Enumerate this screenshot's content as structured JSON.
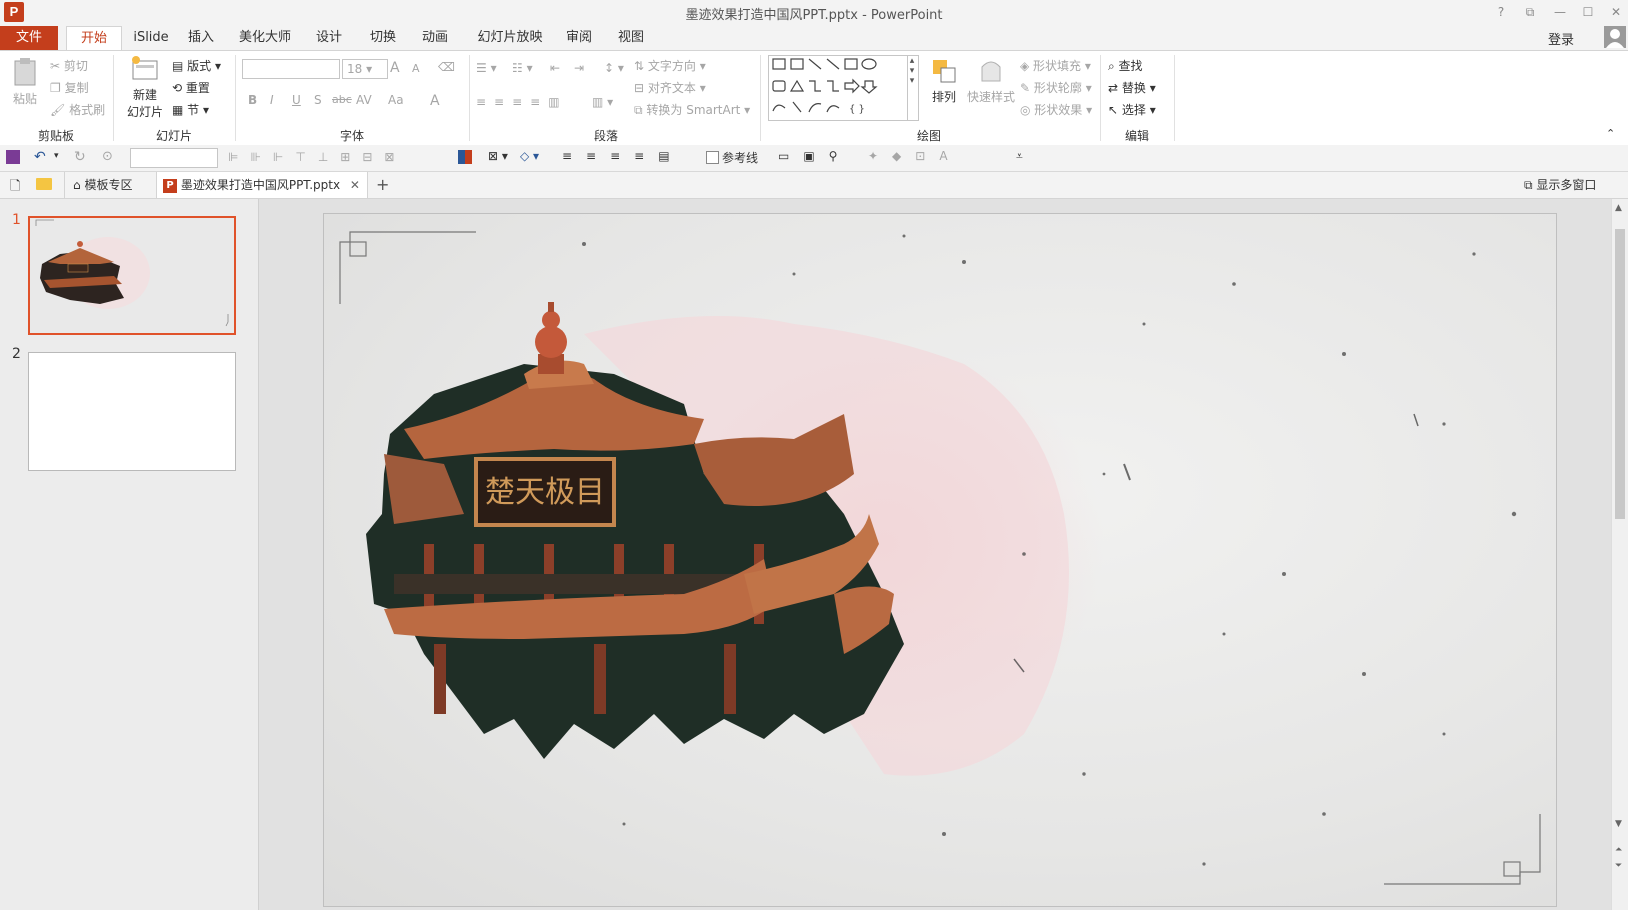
{
  "window": {
    "title": "墨迹效果打造中国风PPT.pptx - PowerPoint",
    "app_icon": "P",
    "controls": [
      "?",
      "⧉",
      "—",
      "☐",
      "✕"
    ],
    "login": "登录"
  },
  "tabs": [
    "文件",
    "开始",
    "iSlide",
    "插入",
    "美化大师",
    "设计",
    "切换",
    "动画",
    "幻灯片放映",
    "审阅",
    "视图"
  ],
  "active_tab": "开始",
  "ribbon": {
    "clipboard": {
      "label": "剪贴板",
      "paste": "粘贴",
      "cut": "剪切",
      "copy": "复制",
      "format_painter": "格式刷"
    },
    "slides": {
      "label": "幻灯片",
      "new_slide_line1": "新建",
      "new_slide_line2": "幻灯片",
      "layout": "版式",
      "reset": "重置",
      "section": "节"
    },
    "font": {
      "label": "字体",
      "font_name": "",
      "font_size": "18",
      "bold": "B",
      "italic": "I",
      "underline": "U",
      "shadow": "S",
      "strike": "abc",
      "spacing": "AV",
      "case": "Aa",
      "color": "A",
      "grow": "A",
      "shrink": "A"
    },
    "paragraph": {
      "label": "段落",
      "text_direction": "文字方向",
      "align_text": "对齐文本",
      "convert_smartart": "转换为 SmartArt"
    },
    "drawing": {
      "label": "绘图",
      "arrange": "排列",
      "quick_styles": "快速样式",
      "shape_fill": "形状填充",
      "shape_outline": "形状轮廓",
      "shape_effects": "形状效果"
    },
    "editing": {
      "label": "编辑",
      "find": "查找",
      "replace": "替换",
      "select": "选择"
    }
  },
  "qat": {
    "guides_label": "参考线"
  },
  "doc_tabs": {
    "template_zone": "模板专区",
    "file_tab": "墨迹效果打造中国风PPT.pptx",
    "multi_window": "显示多窗口"
  },
  "thumbnails": {
    "numbers": [
      "1",
      "2"
    ]
  },
  "slide": {
    "plaque_text": "楚天极目"
  },
  "colors": {
    "accent": "#c43e1c",
    "file_tab": "#c43e1c",
    "selected_thumb": "#e0522a"
  }
}
